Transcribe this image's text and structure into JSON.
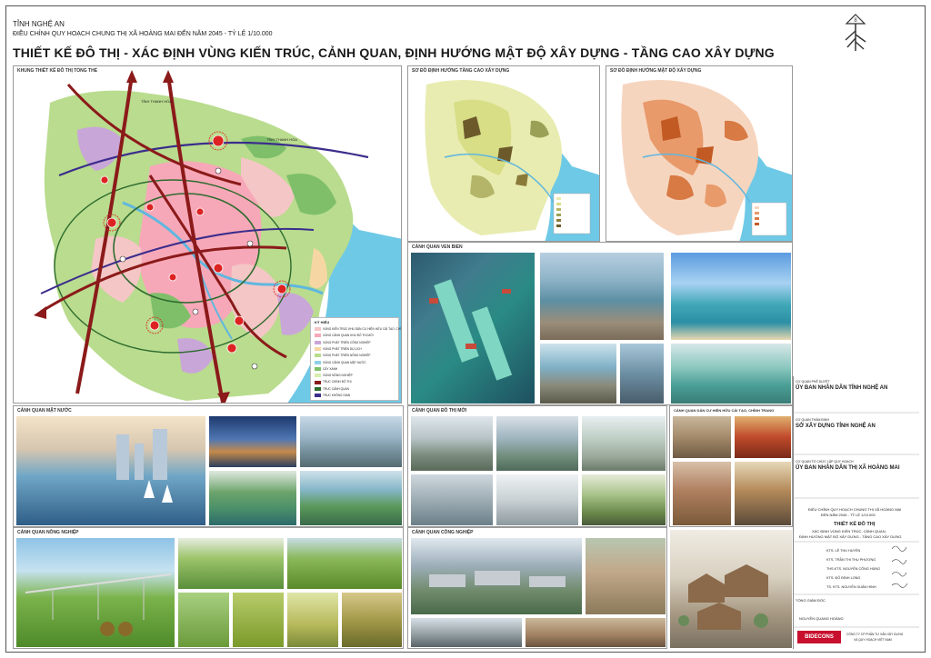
{
  "header": {
    "province": "TỈNH NGHỆ AN",
    "plan_line": "ĐIỀU CHỈNH QUY HOẠCH CHUNG THỊ XÃ HOÀNG MAI ĐẾN NĂM 2045 - TỶ LỆ 1/10.000",
    "title": "THIẾT KẾ ĐÔ THỊ - XÁC ĐỊNH VÙNG KIẾN TRÚC, CẢNH QUAN, ĐỊNH HƯỚNG MẬT ĐỘ XÂY DỰNG - TẦNG CAO XÂY DỰNG"
  },
  "panels": {
    "framework": "KHUNG THIẾT KẾ ĐÔ THỊ TỔNG THỂ",
    "height_map": "SƠ ĐỒ ĐỊNH HƯỚNG TẦNG CAO XÂY DỰNG",
    "density_map": "SƠ ĐỒ ĐỊNH HƯỚNG MẬT ĐỘ XÂY DỰNG",
    "coastal": "CẢNH QUAN VEN BIỂN",
    "water": "CẢNH QUAN MẶT NƯỚC",
    "new_urban": "CẢNH QUAN ĐÔ THỊ MỚI",
    "existing_res": "CẢNH QUAN DÂN CƯ HIỆN HỮU CẢI TẠO, CHỈNH TRANG",
    "agriculture": "CẢNH QUAN NÔNG NGHIỆP",
    "industrial": "CẢNH QUAN CÔNG NGHIỆP"
  },
  "map_labels": {
    "tinh_thanh_hoa_1": "TỈNH THANH HÓA",
    "tinh_thanh_hoa_2": "TỈNH THANH HÓA",
    "legend_title": "KÝ HIỆU"
  },
  "legend": [
    {
      "label": "VÙNG KIẾN TRÚC KHU DÂN CƯ HIỆN HỮU CẢI TẠO, CHỈNH TRANG",
      "color": "#f4c6c6"
    },
    {
      "label": "VÙNG CẢNH QUAN KHU ĐÔ THỊ MỚI",
      "color": "#f7a8b8"
    },
    {
      "label": "VÙNG PHÁT TRIỂN CÔNG NGHIỆP",
      "color": "#c9a6d8"
    },
    {
      "label": "VÙNG PHÁT TRIỂN DU LỊCH",
      "color": "#f6d7a4"
    },
    {
      "label": "VÙNG PHÁT TRIỂN NÔNG NGHIỆP",
      "color": "#b9dc8e"
    },
    {
      "label": "VÙNG CẢNH QUAN MẶT NƯỚC",
      "color": "#8fd0e8"
    },
    {
      "label": "CÂY XANH",
      "color": "#7fbf6a"
    },
    {
      "label": "VÙNG NÔNG NGHIỆP",
      "color": "#d8ecb0"
    },
    {
      "label": "TRỤC CHÍNH ĐÔ THỊ",
      "color": "#8b1a1a"
    },
    {
      "label": "TRỤC CẢNH QUAN",
      "color": "#2e6b2e"
    },
    {
      "label": "TRỤC KHÔNG GIAN",
      "color": "#3b2d8c"
    }
  ],
  "title_block": {
    "approval_label": "CƠ QUAN PHÊ DUYỆT",
    "approval": "ỦY BAN NHÂN DÂN TỈNH NGHỆ AN",
    "appraisal_label": "CƠ QUAN THẨM ĐỊNH",
    "appraisal": "SỞ XÂY DỰNG TỈNH NGHỆ AN",
    "organizer_label": "CƠ QUAN TỔ CHỨC LẬP QUY HOẠCH",
    "organizer": "ỦY BAN NHÂN DÂN THỊ XÃ HOÀNG MAI",
    "project_line1": "ĐIỀU CHỈNH QUY HOẠCH CHUNG THỊ XÃ HOÀNG MAI",
    "project_line2": "ĐẾN NĂM 2045 - TỶ LỆ 1/10.000",
    "drawing_name": "THIẾT KẾ ĐÔ THỊ",
    "drawing_sub1": "XÁC ĐỊNH VÙNG KIẾN TRÚC, CẢNH QUAN,",
    "drawing_sub2": "ĐỊNH HƯỚNG MẬT ĐỘ XÂY DỰNG - TẦNG CAO XÂY DỰNG",
    "staff": [
      "KTS. LÊ THU HUYỀN",
      "KTS. TRẦN THỊ THU PHƯƠNG",
      "THS.KTS. NGUYỄN CÔNG HÙNG",
      "KTS. ĐỖ ĐÌNH LONG",
      "TS. KTS. NGUYỄN XUÂN HINH"
    ],
    "director_label": "TỔNG GIÁM ĐỐC",
    "director": "NGUYỄN QUANG HOÀNG",
    "company_logo": "BIDECONS",
    "company_line1": "CÔNG TY CP PHẦN TƯ VẤN XÂY DỰNG",
    "company_line2": "VÀ QUY HOẠCH VIỆT NAM"
  },
  "colors": {
    "road": "#8b1a1a",
    "green_axis": "#2e6b2e",
    "space_axis": "#3b2d8c",
    "sea": "#6ec9e6"
  }
}
